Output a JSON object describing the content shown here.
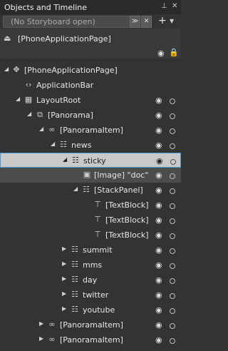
{
  "panel": {
    "title": "Objects and Timeline"
  },
  "storyboard": {
    "value": "(No Storyboard open)"
  },
  "page": {
    "label": "[PhoneApplicationPage]"
  },
  "tree": {
    "r0": "[PhoneApplicationPage]",
    "r1": "ApplicationBar",
    "r2": "LayoutRoot",
    "r3": "[Panorama]",
    "r4": "[PanoramaItem]",
    "r5": "news",
    "r6": "sticky",
    "r7": "[Image] \"doc\"",
    "r8": "[StackPanel]",
    "r9": "[TextBlock]",
    "r10": "[TextBlock]",
    "r11": "[TextBlock]",
    "r12": "summit",
    "r13": "mms",
    "r14": "day",
    "r15": "twitter",
    "r16": "youtube",
    "r17": "[PanoramaItem]",
    "r18": "[PanoramaItem]"
  }
}
